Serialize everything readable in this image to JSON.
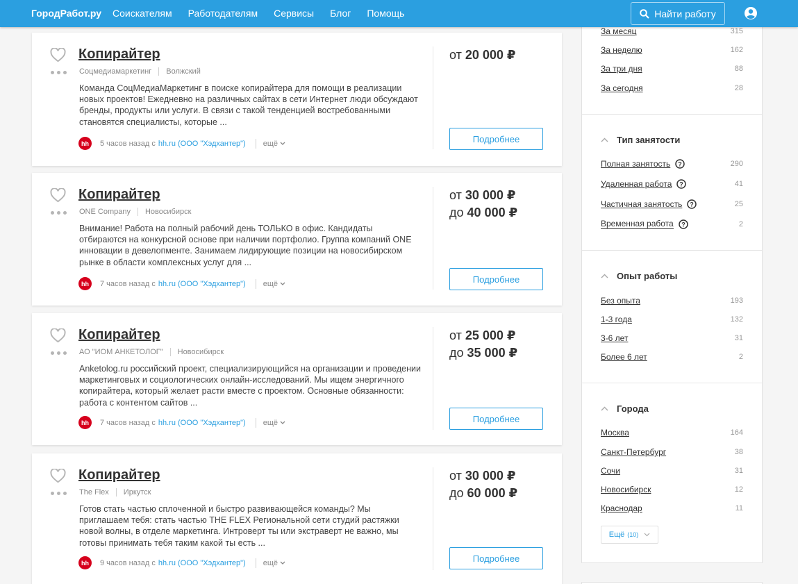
{
  "header": {
    "logo": "ГородРабот.ру",
    "nav": [
      "Соискателям",
      "Работодателям",
      "Сервисы",
      "Блог",
      "Помощь"
    ],
    "find_button": "Найти работу"
  },
  "jobs": [
    {
      "title": "Копирайтер",
      "company": "Соцмедиамаркетинг",
      "city": "Волжский",
      "description": "Команда СоцМедиаМаркетинг в поиске копирайтера для помощи в реализации новых проектов! Ежедневно на различных сайтах в сети Интернет люди обсуждают бренды, продукты или услуги. В связи с такой тенденцией востребованными становятся специалисты, которые ...",
      "time": "5 часов назад с",
      "source": "hh.ru (ООО \"Хэдхантер\")",
      "more": "ещё",
      "salary_from_prefix": "от",
      "salary_from": "20 000 ₽",
      "salary_to_prefix": "",
      "salary_to": "",
      "details_button": "Подробнее"
    },
    {
      "title": "Копирайтер",
      "company": "ONE Company",
      "city": "Новосибирск",
      "description": "Внимание! Работа на полный рабочий день ТОЛЬКО в офис. Кандидаты отбираются на конкурсной основе при наличии портфолио. Группа компаний ONE инновации в девелопменте. Занимаем лидирующие позиции на новосибирском рынке в области комплексных услуг для ...",
      "time": "7 часов назад с",
      "source": "hh.ru (ООО \"Хэдхантер\")",
      "more": "ещё",
      "salary_from_prefix": "от",
      "salary_from": "30 000 ₽",
      "salary_to_prefix": "до",
      "salary_to": "40 000 ₽",
      "details_button": "Подробнее"
    },
    {
      "title": "Копирайтер",
      "company": "АО \"ИОМ АНКЕТОЛОГ\"",
      "city": "Новосибирск",
      "description": "Anketolog.ru российский проект, специализирующийся на организации и проведении маркетинговых и социологических онлайн-исследований. Мы ищем энергичного копирайтера, который желает расти вместе с проектом. Основные обязанности: работа с контентом сайтов ...",
      "time": "7 часов назад с",
      "source": "hh.ru (ООО \"Хэдхантер\")",
      "more": "ещё",
      "salary_from_prefix": "от",
      "salary_from": "25 000 ₽",
      "salary_to_prefix": "до",
      "salary_to": "35 000 ₽",
      "details_button": "Подробнее"
    },
    {
      "title": "Копирайтер",
      "company": "The Flex",
      "city": "Иркутск",
      "description": "Готов стать частью сплоченной и быстро развивающейся команды? Мы приглашаем тебя: стать частью THE FLEX Региональной сети студий растяжки новой волны, в отделе маркетинга. Интроверт ты или экстраверт не важно, мы готовы принимать тебя таким какой ты есть ...",
      "time": "9 часов назад с",
      "source": "hh.ru (ООО \"Хэдхантер\")",
      "more": "ещё",
      "salary_from_prefix": "от",
      "salary_from": "30 000 ₽",
      "salary_to_prefix": "до",
      "salary_to": "60 000 ₽",
      "details_button": "Подробнее"
    }
  ],
  "filters": {
    "period": [
      {
        "label": "За месяц",
        "count": "315"
      },
      {
        "label": "За неделю",
        "count": "162"
      },
      {
        "label": "За три дня",
        "count": "88"
      },
      {
        "label": "За сегодня",
        "count": "28"
      }
    ],
    "employment": {
      "title": "Тип занятости",
      "items": [
        {
          "label": "Полная занятость",
          "count": "290"
        },
        {
          "label": "Удаленная работа",
          "count": "41"
        },
        {
          "label": "Частичная занятость",
          "count": "25"
        },
        {
          "label": "Временная работа",
          "count": "2"
        }
      ]
    },
    "experience": {
      "title": "Опыт работы",
      "items": [
        {
          "label": "Без опыта",
          "count": "193"
        },
        {
          "label": "1-3 года",
          "count": "132"
        },
        {
          "label": "3-6 лет",
          "count": "31"
        },
        {
          "label": "Более 6 лет",
          "count": "2"
        }
      ]
    },
    "cities": {
      "title": "Города",
      "items": [
        {
          "label": "Москва",
          "count": "164"
        },
        {
          "label": "Санкт-Петербург",
          "count": "38"
        },
        {
          "label": "Сочи",
          "count": "31"
        },
        {
          "label": "Новосибирск",
          "count": "12"
        },
        {
          "label": "Краснодар",
          "count": "11"
        }
      ],
      "more_label": "Ещё",
      "more_count": "(10)"
    }
  },
  "colors": {
    "brand": "#2b9fe0",
    "hh": "#d6001c"
  }
}
